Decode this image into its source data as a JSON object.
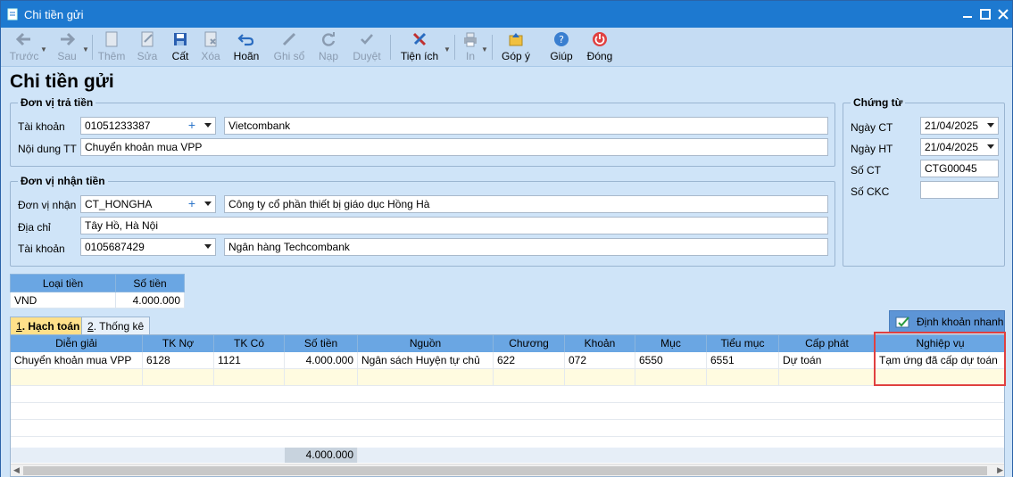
{
  "window": {
    "title": "Chi tiền gửi",
    "icons": [
      "doc-icon",
      "minimize-icon",
      "maximize-icon",
      "close-icon"
    ]
  },
  "toolbar": {
    "prev": "Trước",
    "next": "Sau",
    "add": "Thêm",
    "edit": "Sửa",
    "save": "Cất",
    "delete": "Xóa",
    "undo": "Hoãn",
    "post": "Ghi sổ",
    "load": "Nạp",
    "approve": "Duyệt",
    "utilities": "Tiện ích",
    "print": "In",
    "feedback": "Góp ý",
    "help": "Giúp",
    "close": "Đóng"
  },
  "form": {
    "title": "Chi tiền gửi",
    "payer": {
      "group_title": "Đơn vị trả tiền",
      "account_label": "Tài khoản",
      "account_value": "01051233387",
      "bank_name": "Vietcombank",
      "content_label": "Nội dung TT",
      "content_value": "Chuyển khoản mua VPP"
    },
    "payee": {
      "group_title": "Đơn vị nhận tiền",
      "unit_label": "Đơn vị nhận",
      "unit_value": "CT_HONGHA",
      "unit_name": "Công ty cổ phần thiết bị giáo dục Hồng Hà",
      "address_label": "Địa chỉ",
      "address_value": "Tây Hồ, Hà Nội",
      "account_label": "Tài khoản",
      "account_value": "0105687429",
      "bank_name": "Ngân hàng Techcombank"
    },
    "voucher": {
      "group_title": "Chứng từ",
      "date_label": "Ngày CT",
      "date_value": "21/04/2025",
      "post_date_label": "Ngày HT",
      "post_date_value": "21/04/2025",
      "number_label": "Số CT",
      "number_value": "CTG00045",
      "ckc_label": "Số CKC",
      "ckc_value": ""
    },
    "currency_table": {
      "headers": [
        "Loại tiền",
        "Số tiền"
      ],
      "row": [
        "VND",
        "4.000.000"
      ]
    }
  },
  "tabs": [
    {
      "num": "1",
      "label": ". Hạch toán"
    },
    {
      "num": "2",
      "label": ". Thống kê"
    }
  ],
  "quick_button": "Định khoản nhanh",
  "grid": {
    "headers": [
      "Diễn giải",
      "TK Nợ",
      "TK Có",
      "Số tiền",
      "Nguồn",
      "Chương",
      "Khoản",
      "Mục",
      "Tiểu mục",
      "Cấp phát",
      "Nghiệp vụ"
    ],
    "rows": [
      [
        "Chuyển khoản mua VPP",
        "6128",
        "1121",
        "4.000.000",
        "Ngân sách Huyện tự chủ",
        "622",
        "072",
        "6550",
        "6551",
        "Dự toán",
        "Tạm ứng đã cấp dự toán"
      ]
    ],
    "total": "4.000.000"
  }
}
